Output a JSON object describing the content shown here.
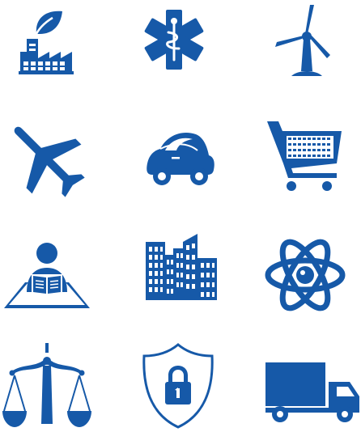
{
  "accent_color": "#1659a8",
  "background_color": "#ffffff",
  "icons": [
    {
      "name": "factory-icon"
    },
    {
      "name": "medical-star-of-life-icon"
    },
    {
      "name": "wind-turbine-icon"
    },
    {
      "name": "airplane-icon"
    },
    {
      "name": "eco-car-icon"
    },
    {
      "name": "shopping-cart-icon"
    },
    {
      "name": "reader-education-icon"
    },
    {
      "name": "city-buildings-icon"
    },
    {
      "name": "atom-science-icon"
    },
    {
      "name": "scales-of-justice-icon"
    },
    {
      "name": "security-shield-lock-icon"
    },
    {
      "name": "delivery-truck-icon"
    }
  ]
}
